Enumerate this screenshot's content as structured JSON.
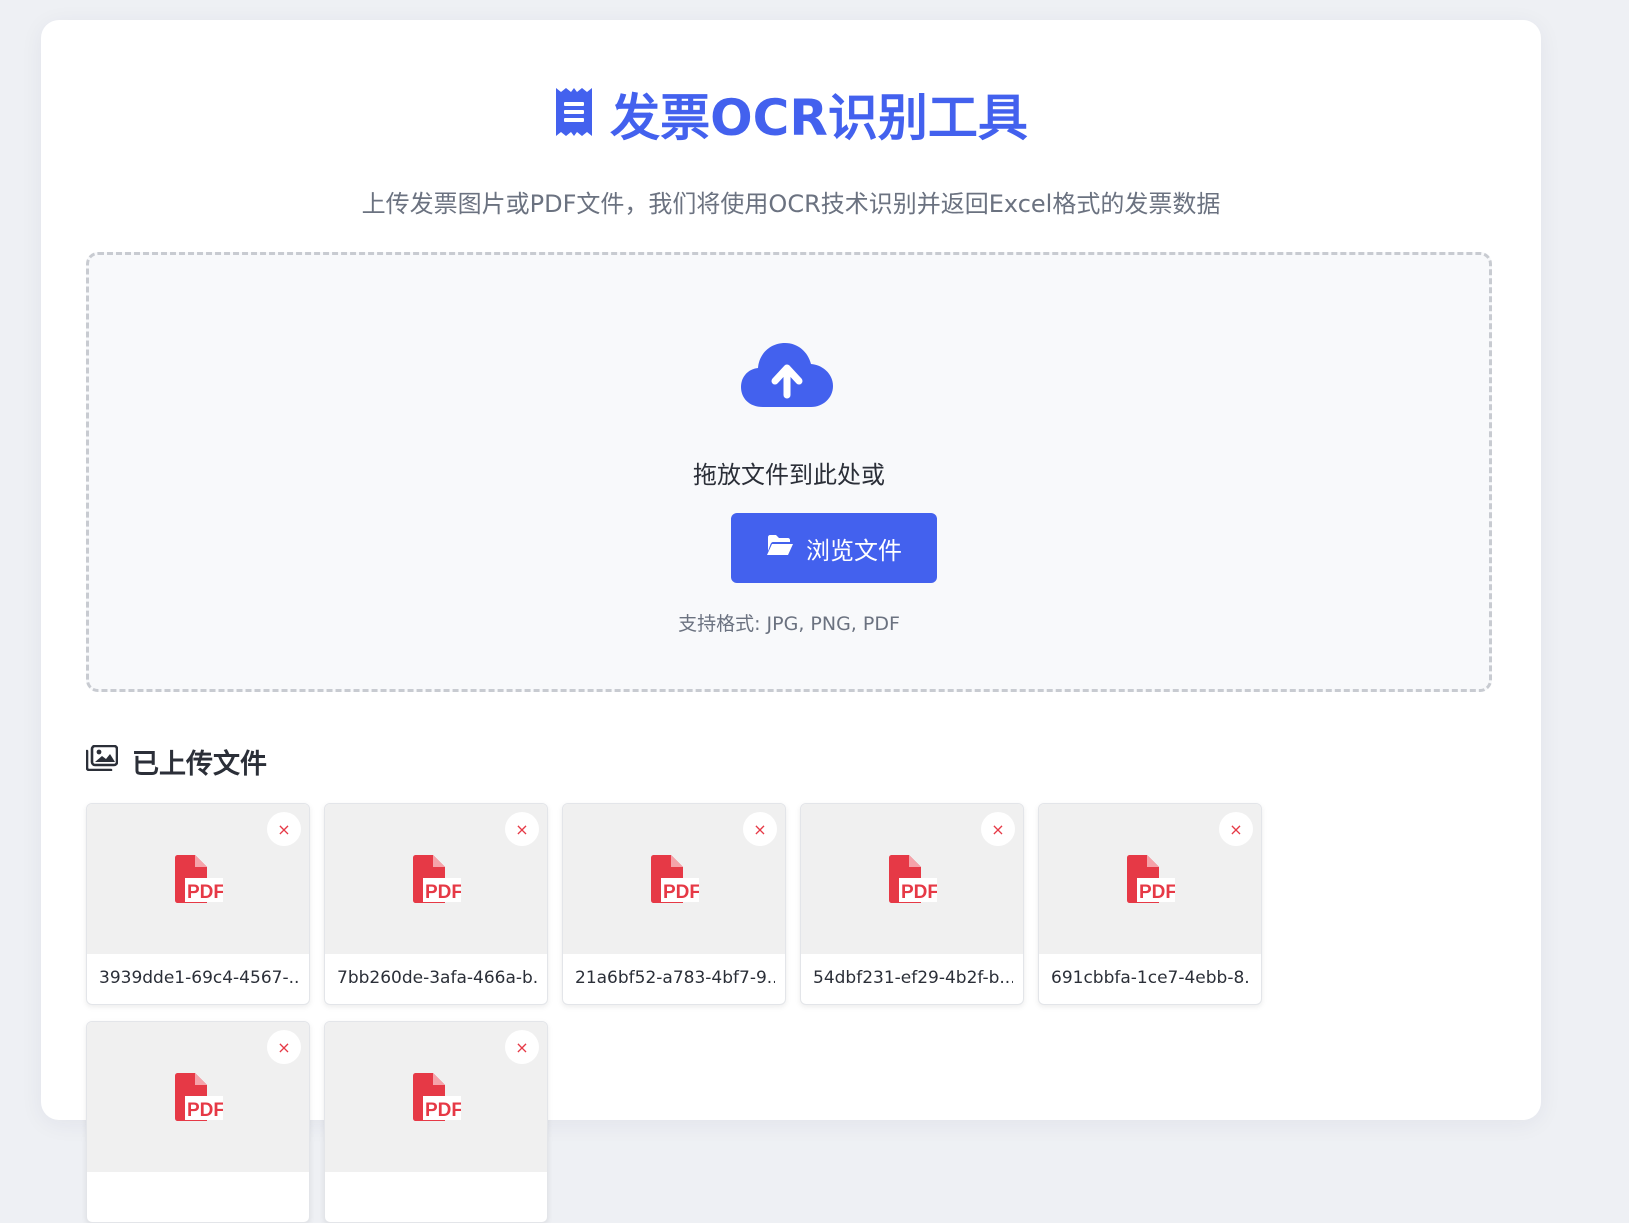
{
  "header": {
    "icon": "receipt-icon",
    "title": "发票OCR识别工具",
    "subtitle": "上传发票图片或PDF文件，我们将使用OCR技术识别并返回Excel格式的发票数据"
  },
  "upload": {
    "icon": "cloud-upload-icon",
    "drop_text": "拖放文件到此处或",
    "browse_icon": "folder-open-icon",
    "browse_label": "浏览文件",
    "formats_text": "支持格式: JPG, PNG, PDF"
  },
  "files_section": {
    "icon": "images-icon",
    "title": "已上传文件",
    "remove_symbol": "×",
    "files": [
      {
        "name": "3939dde1-69c4-4567-...",
        "type": "PDF"
      },
      {
        "name": "7bb260de-3afa-466a-b...",
        "type": "PDF"
      },
      {
        "name": "21a6bf52-a783-4bf7-9...",
        "type": "PDF"
      },
      {
        "name": "54dbf231-ef29-4b2f-b...",
        "type": "PDF"
      },
      {
        "name": "691cbbfa-1ce7-4ebb-8...",
        "type": "PDF"
      },
      {
        "name": "",
        "type": "PDF"
      },
      {
        "name": "",
        "type": "PDF"
      }
    ]
  },
  "colors": {
    "accent": "#4361ee",
    "pdf_red": "#e63946",
    "background": "#eef0f4"
  }
}
